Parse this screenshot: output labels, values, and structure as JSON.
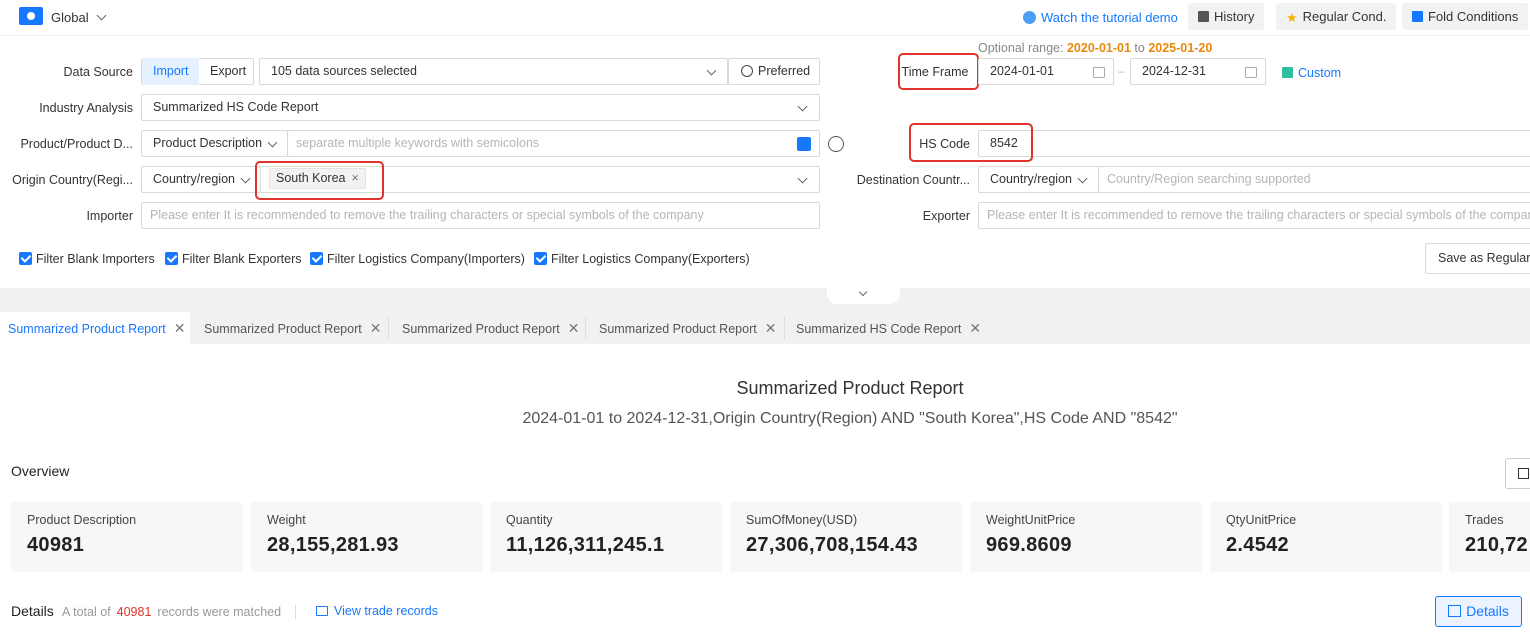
{
  "topbar": {
    "scope_label": "Global",
    "tutorial_label": "Watch the tutorial demo",
    "history_label": "History",
    "regular_label": "Regular Cond.",
    "fold_label": "Fold Conditions"
  },
  "form": {
    "optional_range_label": "Optional range:",
    "optional_range_from": "2020-01-01",
    "optional_range_to_word": "to",
    "optional_range_to": "2025-01-20",
    "data_source_label": "Data Source",
    "import_label": "Import",
    "export_label": "Export",
    "data_sources_value": "105 data sources selected",
    "preferred_label": "Preferred",
    "time_frame_label": "Time Frame",
    "date_start": "2024-01-01",
    "date_sep": "–",
    "date_end": "2024-12-31",
    "custom_label": "Custom",
    "industry_label": "Industry Analysis",
    "industry_value": "Summarized HS Code Report",
    "product_label": "Product/Product D...",
    "product_type": "Product Description",
    "product_placeholder": "separate multiple keywords with semicolons",
    "hs_label": "HS Code",
    "hs_value": "8542",
    "origin_label": "Origin Country(Regi...",
    "origin_type": "Country/region",
    "origin_tag": "South Korea",
    "dest_label": "Destination Countr...",
    "dest_type": "Country/region",
    "dest_placeholder": "Country/Region searching supported",
    "importer_label": "Importer",
    "importer_placeholder": "Please enter It is recommended to remove the trailing characters or special symbols of the company",
    "exporter_label": "Exporter",
    "exporter_placeholder": "Please enter It is recommended to remove the trailing characters or special symbols of the company",
    "filters": [
      "Filter Blank Importers",
      "Filter Blank Exporters",
      "Filter Logistics Company(Importers)",
      "Filter Logistics Company(Exporters)"
    ],
    "save_regular_label": "Save as Regular"
  },
  "tabs": [
    "Summarized Product Report",
    "Summarized Product Report",
    "Summarized Product Report",
    "Summarized Product Report",
    "Summarized HS Code Report"
  ],
  "report": {
    "title": "Summarized Product Report",
    "subtitle": "2024-01-01 to 2024-12-31,Origin Country(Region) AND \"South Korea\",HS Code AND \"8542\"",
    "overview_label": "Overview",
    "cards": [
      {
        "label": "Product Description",
        "value": "40981"
      },
      {
        "label": "Weight",
        "value": "28,155,281.93"
      },
      {
        "label": "Quantity",
        "value": "11,126,311,245.1"
      },
      {
        "label": "SumOfMoney(USD)",
        "value": "27,306,708,154.43"
      },
      {
        "label": "WeightUnitPrice",
        "value": "969.8609"
      },
      {
        "label": "QtyUnitPrice",
        "value": "2.4542"
      },
      {
        "label": "Trades",
        "value": "210,72"
      }
    ],
    "details_label": "Details",
    "total_prefix": "A total of",
    "total_count": "40981",
    "total_suffix": "records were matched",
    "view_records_label": "View trade records",
    "details_button": "Details"
  },
  "colors": {
    "accent": "#1677ff",
    "highlight_red": "#e0332b",
    "range_orange": "#e8890c"
  }
}
